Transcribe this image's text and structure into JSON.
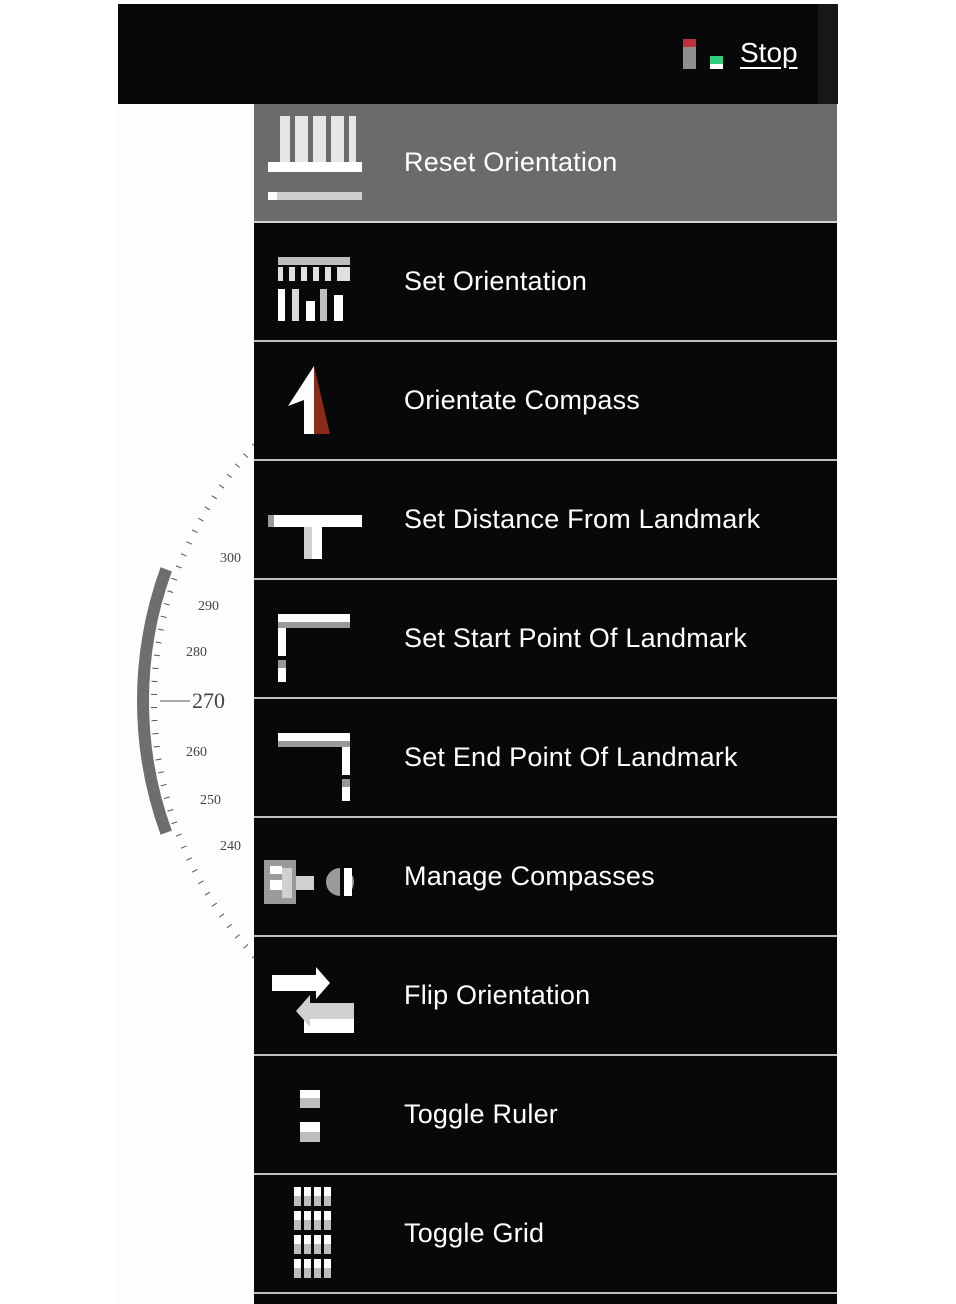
{
  "header": {
    "stop_label": "Stop",
    "status_icon": "recording-status-icon"
  },
  "compass": {
    "tick_labels": [
      "300",
      "290",
      "280",
      "270",
      "260",
      "250",
      "240"
    ]
  },
  "menu": {
    "items": [
      {
        "label": "Reset Orientation",
        "icon": "reset-orientation-icon",
        "selected": true
      },
      {
        "label": "Set Orientation",
        "icon": "set-orientation-icon",
        "selected": false
      },
      {
        "label": "Orientate Compass",
        "icon": "orientate-compass-icon",
        "selected": false
      },
      {
        "label": "Set Distance From Landmark",
        "icon": "distance-landmark-icon",
        "selected": false
      },
      {
        "label": "Set Start Point Of Landmark",
        "icon": "start-point-icon",
        "selected": false
      },
      {
        "label": "Set End Point Of Landmark",
        "icon": "end-point-icon",
        "selected": false
      },
      {
        "label": "Manage Compasses",
        "icon": "manage-compasses-icon",
        "selected": false
      },
      {
        "label": "Flip Orientation",
        "icon": "flip-orientation-icon",
        "selected": false
      },
      {
        "label": "Toggle Ruler",
        "icon": "ruler-icon",
        "selected": false
      },
      {
        "label": "Toggle Grid",
        "icon": "grid-icon",
        "selected": false
      }
    ]
  },
  "colors": {
    "menu_bg": "#060809",
    "selected_bg": "#6c6b6b",
    "divider": "#bfbfbf",
    "status_red": "#c0303c",
    "status_green": "#2fcf7e",
    "compass_arrow_red": "#8a2a18"
  }
}
